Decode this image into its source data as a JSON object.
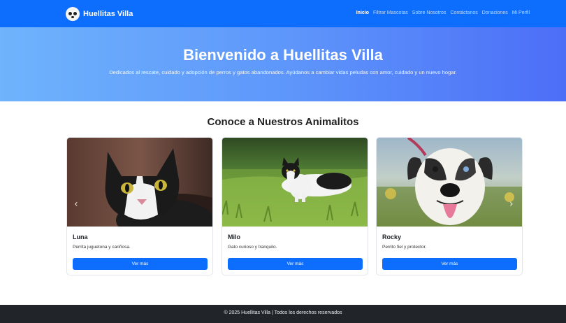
{
  "navbar": {
    "brand": "Huellitas Villa",
    "brand_icon": "dog-face-icon",
    "links": [
      {
        "label": "Inicio",
        "active": true
      },
      {
        "label": "Filtrar Mascotas",
        "active": false
      },
      {
        "label": "Sobre Nosotros",
        "active": false
      },
      {
        "label": "Contáctanos",
        "active": false
      },
      {
        "label": "Donaciones",
        "active": false
      },
      {
        "label": "Mi Perfil",
        "active": false
      }
    ]
  },
  "hero": {
    "title": "Bienvenido a Huellitas Villa",
    "subtitle": "Dedicados al rescate, cuidado y adopción de perros y gatos abandonados. Ayúdanos a cambiar vidas peludas con amor, cuidado y un nuevo hogar."
  },
  "section": {
    "title": "Conoce a Nuestros Animalitos"
  },
  "cards": [
    {
      "name": "Luna",
      "description": "Perrita juguetona y cariñosa.",
      "button": "Ver más",
      "image": "cat-photo"
    },
    {
      "name": "Milo",
      "description": "Gato curioso y tranquilo.",
      "button": "Ver más",
      "image": "cat-in-grass-photo"
    },
    {
      "name": "Rocky",
      "description": "Perrito fiel y protector.",
      "button": "Ver más",
      "image": "dog-photo"
    }
  ],
  "carousel": {
    "prev_icon": "chevron-left-icon",
    "next_icon": "chevron-right-icon"
  },
  "footer": {
    "text": "© 2025 Huellitas Villa | Todos los derechos reservados"
  },
  "colors": {
    "primary": "#0d6efd",
    "footer_bg": "#212529",
    "hero_start": "#6fb3fc",
    "hero_end": "#4c6ef7"
  }
}
